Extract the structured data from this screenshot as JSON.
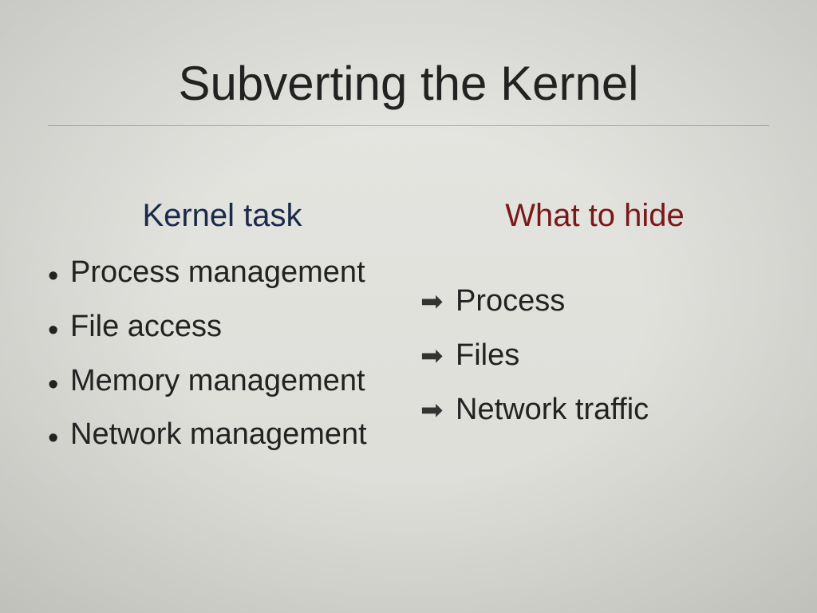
{
  "title": "Subverting the Kernel",
  "left": {
    "header": "Kernel task",
    "items": [
      "Process management",
      "File access",
      "Memory management",
      "Network management"
    ]
  },
  "right": {
    "header": "What to hide",
    "items": [
      "Process",
      "Files",
      "Network traffic"
    ]
  }
}
